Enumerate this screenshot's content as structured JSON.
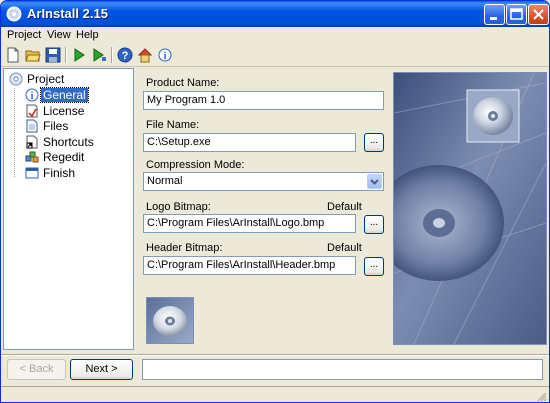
{
  "window": {
    "title": "ArInstall 2.15"
  },
  "menu": [
    "Project",
    "View",
    "Help"
  ],
  "toolbar_icons": [
    "new-icon",
    "open-icon",
    "save-icon",
    "build-icon",
    "run-icon",
    "help-icon",
    "home-icon",
    "about-icon"
  ],
  "tree": {
    "root": {
      "label": "Project",
      "icon": "project-icon"
    },
    "items": [
      {
        "label": "General",
        "icon": "info-icon",
        "selected": true
      },
      {
        "label": "License",
        "icon": "license-icon",
        "selected": false
      },
      {
        "label": "Files",
        "icon": "files-icon",
        "selected": false
      },
      {
        "label": "Shortcuts",
        "icon": "shortcut-icon",
        "selected": false
      },
      {
        "label": "Regedit",
        "icon": "registry-icon",
        "selected": false
      },
      {
        "label": "Finish",
        "icon": "finish-icon",
        "selected": false
      }
    ]
  },
  "form": {
    "product_name_label": "Product Name:",
    "product_name_value": "My Program 1.0",
    "file_name_label": "File Name:",
    "file_name_value": "C:\\Setup.exe",
    "compression_label": "Compression Mode:",
    "compression_value": "Normal",
    "logo_label": "Logo Bitmap:",
    "logo_default": "Default",
    "logo_value": "C:\\Program Files\\ArInstall\\Logo.bmp",
    "header_label": "Header Bitmap:",
    "header_default": "Default",
    "header_value": "C:\\Program Files\\ArInstall\\Header.bmp",
    "browse_label": "..."
  },
  "buttons": {
    "back": "< Back",
    "next": "Next >"
  },
  "colors": {
    "titlebar": "#0054e3",
    "selection": "#316ac5",
    "face": "#ece9d8"
  }
}
